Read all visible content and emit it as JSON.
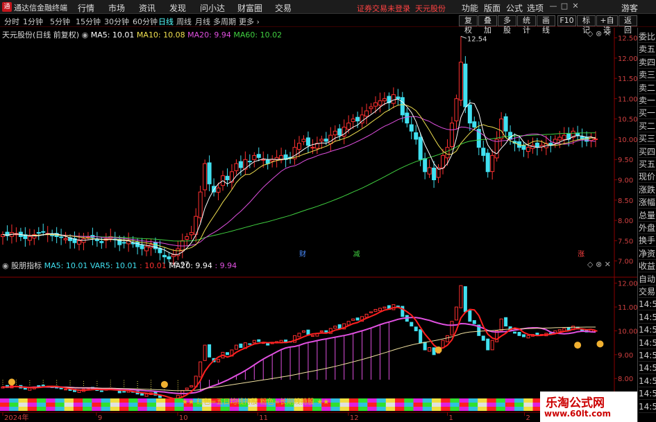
{
  "app": {
    "title": "通达信金融终端",
    "logo": "通",
    "warning": "证券交易未登录",
    "stock": "天元股份"
  },
  "menu": [
    "行情",
    "市场",
    "资讯",
    "发现",
    "问小达",
    "财富圈",
    "交易"
  ],
  "right_menu": [
    "功能",
    "版面",
    "公式",
    "选项",
    "游客"
  ],
  "window_controls": {
    "min": "—",
    "max": "□",
    "close": "✕"
  },
  "periods": [
    "分时",
    "1分钟",
    "5分钟",
    "15分钟",
    "30分钟",
    "60分钟",
    "日线",
    "周线",
    "月线",
    "多周期",
    "更多"
  ],
  "active_period": "日线",
  "tools": [
    "复权",
    "叠加",
    "多股",
    "统计",
    "画线",
    "F10",
    "标记",
    "+自选",
    "返回"
  ],
  "main_legend": {
    "title": "天元股份(日线 前复权)",
    "ma5": "MA5: 10.01",
    "ma10": "MA10: 10.08",
    "ma20": "MA20: 9.94",
    "ma60": "MA60: 10.02"
  },
  "ind_legend": {
    "title": "股朋指标",
    "ma5": "MA5: 10.01",
    "var5": "VAR5: 10.01",
    "v3": ": 10.01",
    "ma20": "MA20: 9.94",
    "v5": ": 9.94"
  },
  "colors": {
    "ma5": "#ffffff",
    "ma10": "#f0e050",
    "ma20": "#e050e0",
    "ma60": "#40d040",
    "up": "#ff3030",
    "down": "#40e0f0"
  },
  "events": [
    {
      "label": "财",
      "color": "#4a8cff"
    },
    {
      "label": "减",
      "color": "#40d040"
    },
    {
      "label": "涨",
      "color": "#ff4040"
    }
  ],
  "annotations": {
    "high": "12.54",
    "low": "6.97"
  },
  "signal_text": "红色=五日均线持股  粉色=长期线持股",
  "signal_text_color": "#e0c020",
  "x_axis": [
    "2024年",
    "9",
    "10",
    "11",
    "12",
    "1",
    "2"
  ],
  "sidebar": [
    "委比",
    "卖五",
    "卖四",
    "卖三",
    "卖二",
    "卖一",
    "买一",
    "买二",
    "买三",
    "买四",
    "买五",
    "现价",
    "涨跌",
    "涨幅",
    "总量",
    "外盘",
    "换手",
    "净资",
    "收益",
    "自动",
    "交易",
    "14:56",
    "14:56",
    "14:56",
    "14:56",
    "14:56",
    "14:56",
    "14:56",
    "14:56",
    "14:56"
  ],
  "watermark": {
    "line1": "乐淘公式网",
    "line2": "www.60lt.com"
  },
  "chart_data": [
    {
      "type": "candlestick",
      "title": "天元股份(日线 前复权)",
      "ylim": [
        6.6,
        12.75
      ],
      "yticks": [
        "7.00",
        "7.50",
        "8.00",
        "8.50",
        "9.00",
        "9.50",
        "10.00",
        "10.50",
        "11.00",
        "11.50",
        "12.00",
        "12.50"
      ],
      "x_ticks": [
        "2024年",
        "9",
        "10",
        "11",
        "12",
        "1",
        "2"
      ],
      "series": [
        {
          "name": "MA5",
          "value": 10.01
        },
        {
          "name": "MA10",
          "value": 10.08
        },
        {
          "name": "MA20",
          "value": 9.94
        },
        {
          "name": "MA60",
          "value": 10.02
        }
      ],
      "close": [
        7.65,
        7.62,
        7.7,
        7.68,
        7.6,
        7.55,
        7.6,
        7.65,
        7.7,
        7.72,
        7.68,
        7.62,
        7.6,
        7.58,
        7.55,
        7.5,
        7.45,
        7.5,
        7.55,
        7.6,
        7.58,
        7.5,
        7.45,
        7.55,
        7.6,
        7.52,
        7.4,
        7.45,
        7.5,
        7.42,
        7.35,
        7.3,
        7.35,
        7.4,
        7.3,
        7.2,
        7.1,
        7.05,
        7.15,
        7.3,
        7.5,
        7.6,
        7.7,
        8.1,
        8.7,
        9.4,
        8.9,
        8.7,
        8.8,
        9.1,
        9.0,
        9.2,
        9.4,
        9.3,
        9.5,
        9.45,
        9.6,
        9.55,
        9.5,
        9.4,
        9.5,
        9.55,
        9.6,
        9.5,
        9.55,
        9.8,
        9.9,
        10.0,
        9.85,
        9.8,
        9.9,
        10.0,
        9.95,
        10.1,
        10.2,
        10.1,
        10.3,
        10.4,
        10.5,
        10.45,
        10.6,
        10.7,
        10.8,
        10.9,
        10.95,
        11.0,
        10.9,
        11.1,
        11.0,
        10.6,
        10.4,
        10.2,
        10.0,
        9.5,
        9.2,
        9.3,
        9.0,
        9.3,
        9.6,
        9.8,
        10.4,
        11.0,
        11.9,
        10.8,
        10.4,
        10.3,
        9.8,
        9.6,
        9.2,
        9.6,
        10.0,
        10.5,
        10.2,
        10.0,
        9.9,
        9.8,
        9.75,
        9.8,
        9.85,
        9.8,
        9.85,
        9.9,
        9.85,
        10.0,
        10.05,
        10.1,
        10.0,
        10.2,
        10.1,
        10.0,
        9.95,
        10.05,
        10.01
      ],
      "high": 12.54,
      "low": 6.97
    },
    {
      "type": "indicator",
      "title": "股朋指标",
      "ylim": [
        7.6,
        12.6
      ],
      "yticks": [
        "8.00",
        "9.00",
        "10.00",
        "11.00",
        "12.00"
      ],
      "series": [
        {
          "name": "MA5",
          "value": 10.01
        },
        {
          "name": "VAR5",
          "value": 10.01
        },
        {
          "name": "MA20",
          "value": 9.94
        }
      ]
    }
  ]
}
